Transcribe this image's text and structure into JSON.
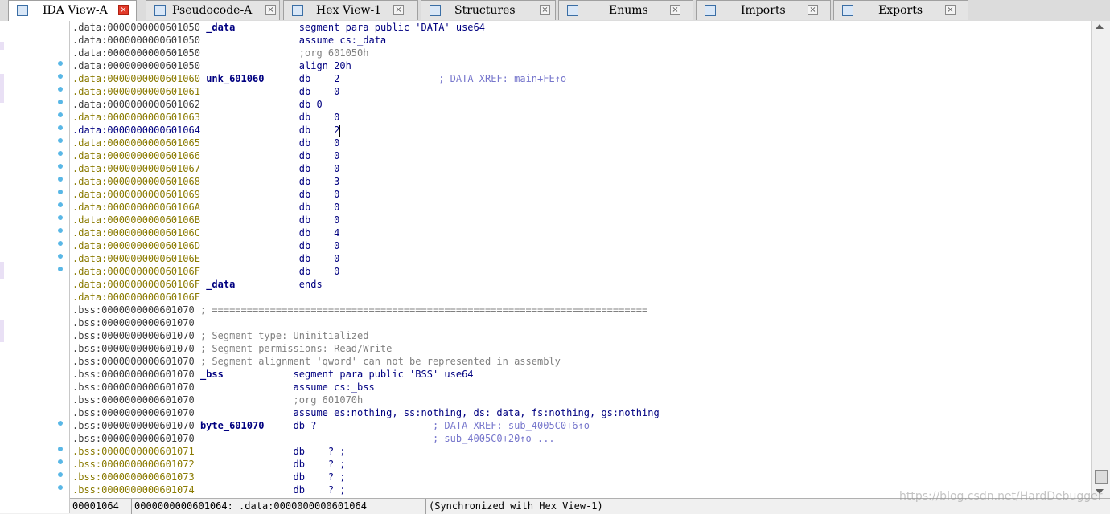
{
  "tabs": [
    {
      "label": "IDA View-A",
      "icon": "ida-view-icon",
      "active": true
    },
    {
      "label": "Pseudocode-A",
      "icon": "pseudocode-icon",
      "active": false
    },
    {
      "label": "Hex View-1",
      "icon": "hex-view-icon",
      "active": false
    },
    {
      "label": "Structures",
      "icon": "structures-icon",
      "active": false
    },
    {
      "label": "Enums",
      "icon": "enums-icon",
      "active": false
    },
    {
      "label": "Imports",
      "icon": "imports-icon",
      "active": false
    },
    {
      "label": "Exports",
      "icon": "exports-icon",
      "active": false
    }
  ],
  "close_glyph": "×",
  "listing": {
    "lines": [
      {
        "addr": ".data:0000000000601050",
        "name": "_data",
        "op": "segment para public 'DATA' use64"
      },
      {
        "addr": ".data:0000000000601050",
        "op": "assume cs:_data"
      },
      {
        "addr": ".data:0000000000601050",
        "op": ";org 601050h"
      },
      {
        "addr": ".data:0000000000601050",
        "op": "align 20h"
      },
      {
        "addr": ".data:0000000000601060",
        "name": "unk_601060",
        "op": "db    2",
        "xref": "; DATA XREF: main+FE↑o"
      },
      {
        "addr": ".data:0000000000601061",
        "op": "db    0"
      },
      {
        "addr": ".data:0000000000601062",
        "op": "db 0"
      },
      {
        "addr": ".data:0000000000601063",
        "op": "db    0"
      },
      {
        "addr": ".data:0000000000601064",
        "op": "db    2"
      },
      {
        "addr": ".data:0000000000601065",
        "op": "db    0"
      },
      {
        "addr": ".data:0000000000601066",
        "op": "db    0"
      },
      {
        "addr": ".data:0000000000601067",
        "op": "db    0"
      },
      {
        "addr": ".data:0000000000601068",
        "op": "db    3"
      },
      {
        "addr": ".data:0000000000601069",
        "op": "db    0"
      },
      {
        "addr": ".data:000000000060106A",
        "op": "db    0"
      },
      {
        "addr": ".data:000000000060106B",
        "op": "db    0"
      },
      {
        "addr": ".data:000000000060106C",
        "op": "db    4"
      },
      {
        "addr": ".data:000000000060106D",
        "op": "db    0"
      },
      {
        "addr": ".data:000000000060106E",
        "op": "db    0"
      },
      {
        "addr": ".data:000000000060106F",
        "op": "db    0"
      },
      {
        "addr": ".data:000000000060106F",
        "name": "_data",
        "op": "ends"
      },
      {
        "addr": ".data:000000000060106F"
      },
      {
        "addr": ".bss:0000000000601070",
        "comment": "; ==========================================================================="
      },
      {
        "addr": ".bss:0000000000601070"
      },
      {
        "addr": ".bss:0000000000601070",
        "comment": "; Segment type: Uninitialized"
      },
      {
        "addr": ".bss:0000000000601070",
        "comment": "; Segment permissions: Read/Write"
      },
      {
        "addr": ".bss:0000000000601070",
        "comment": "; Segment alignment 'qword' can not be represented in assembly"
      },
      {
        "addr": ".bss:0000000000601070",
        "name": "_bss",
        "op": "segment para public 'BSS' use64"
      },
      {
        "addr": ".bss:0000000000601070",
        "op": "assume cs:_bss"
      },
      {
        "addr": ".bss:0000000000601070",
        "op": ";org 601070h"
      },
      {
        "addr": ".bss:0000000000601070",
        "op": "assume es:nothing, ss:nothing, ds:_data, fs:nothing, gs:nothing"
      },
      {
        "addr": ".bss:0000000000601070",
        "name": "byte_601070",
        "op": "db ?",
        "xref": "; DATA XREF: sub_4005C0+6↑o"
      },
      {
        "addr": ".bss:0000000000601070",
        "xref": "; sub_4005C0+20↑o ..."
      },
      {
        "addr": ".bss:0000000000601071",
        "op": "db    ? ;"
      },
      {
        "addr": ".bss:0000000000601072",
        "op": "db    ? ;"
      },
      {
        "addr": ".bss:0000000000601073",
        "op": "db    ? ;"
      },
      {
        "addr": ".bss:0000000000601074",
        "op": "db    ? ;"
      }
    ]
  },
  "status": {
    "offset": "00001064",
    "location": "0000000000601064: .data:0000000000601064",
    "sync": "(Synchronized with Hex View-1)"
  },
  "watermark": "https://blog.csdn.net/HardDebugger",
  "colors": {
    "address_gray": "#3b3b3b",
    "address_olive": "#8a7a00",
    "address_current": "#000080",
    "mnemonic_blue": "#000080",
    "value_green": "#008040",
    "xref_purple": "#7777cc",
    "comment_gray": "#808080",
    "flow_dot": "#59b7e6",
    "active_close": "#e23a2a"
  }
}
